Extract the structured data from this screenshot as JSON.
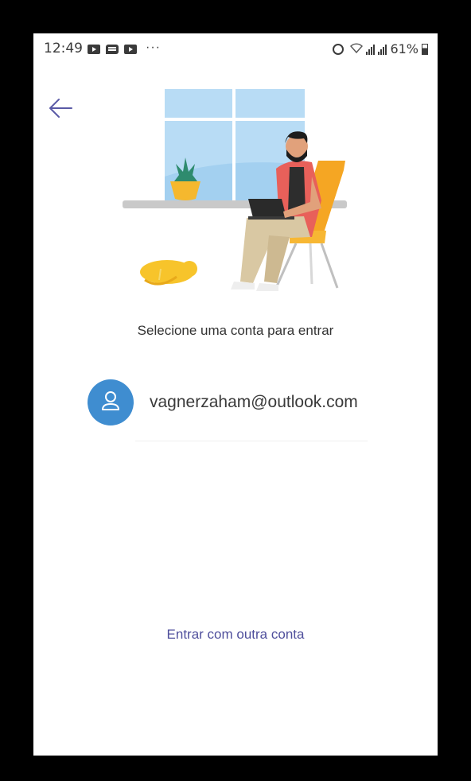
{
  "status_bar": {
    "time": "12:49",
    "left_icons": [
      "video-icon",
      "chat-icon",
      "video-icon"
    ],
    "overflow": "···",
    "battery_percent": "61%"
  },
  "header": {
    "back_icon": "arrow-left-icon"
  },
  "illustration": {
    "description_icon": "person-working-on-laptop-illustration"
  },
  "main": {
    "prompt": "Selecione uma conta para entrar",
    "accounts": [
      {
        "email": "vagnerzaham@outlook.com",
        "avatar_icon": "person-icon"
      }
    ],
    "other_account_link": "Entrar com outra conta"
  },
  "colors": {
    "accent": "#4f4f9c",
    "avatar": "#3f8dd0",
    "frame": "#000000",
    "background": "#ffffff"
  }
}
